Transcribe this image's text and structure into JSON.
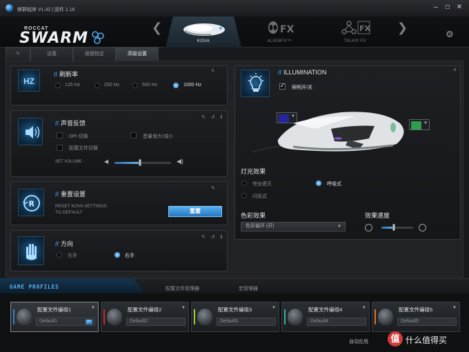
{
  "window": {
    "title": "蜂群程序 V1.42 | 固件 1.16",
    "minimize": "–",
    "maximize": "☐",
    "close": "✕"
  },
  "brand": {
    "small": "ROCCAT",
    "big": "SWARM"
  },
  "device_nav": {
    "prev": "❮",
    "next": "❯",
    "tabs": [
      {
        "label": "KOVA"
      },
      {
        "label": "ALIENFX™"
      },
      {
        "label": "TALK® FX"
      }
    ]
  },
  "section_tabs": {
    "pin": "✎",
    "items": [
      "设置",
      "按键指定",
      "高级设置"
    ],
    "active": 2
  },
  "polling": {
    "title": "刷新率",
    "tile": "HZ",
    "options": [
      "125 Hz",
      "250 Hz",
      "500 Hz",
      "1000 Hz"
    ],
    "selected": 3
  },
  "sound": {
    "title": "声音反馈",
    "opt_dpi": "DPI 切换",
    "opt_volume": "音量增大/减小",
    "opt_profile": "配置文件切换",
    "volume_label": "SET VOLUME :",
    "volume_level": 0.45
  },
  "reset": {
    "title": "重置设置",
    "tile": "R",
    "line1": "RESET KOVA SETTINGS",
    "line2": "TO DEFAULT",
    "button": "重置"
  },
  "orientation": {
    "title": "方向",
    "left": "左手",
    "right": "右手",
    "selected": "right"
  },
  "card_tools": "✎ ↺ ℹ",
  "illumination": {
    "title": "ILLUMINATION",
    "toggle": "照明开/关",
    "toggle_on": true,
    "left_color": "#26269a",
    "right_color": "#2e9e4d",
    "effects_title": "灯光效果",
    "effects": [
      "完全熄灭",
      "呼吸式",
      "闪烁式"
    ],
    "effect_selected": "呼吸式",
    "color_title": "色彩效果",
    "color_value": "色彩循环 (开)",
    "speed_title": "效果速度",
    "speed_level": 0.4
  },
  "profiles": {
    "header": "GAME PROFILES",
    "action1": "配置文件管理器",
    "action2": "宏管理器",
    "items": [
      {
        "name": "配置文件编组1",
        "default": "Default1",
        "accent": "#2f86d2",
        "badge": "DP"
      },
      {
        "name": "配置文件编组2",
        "default": "Default2",
        "accent": "#cf2b2b"
      },
      {
        "name": "配置文件编组3",
        "default": "Default3",
        "accent": "#9bd02b"
      },
      {
        "name": "配置文件编组4",
        "default": "Default4",
        "accent": "#28b89a"
      },
      {
        "name": "配置文件编组5",
        "default": "Default5",
        "accent": "#e0731e"
      }
    ],
    "autoapply": "自动应用"
  },
  "watermark": "值 什么值得买"
}
